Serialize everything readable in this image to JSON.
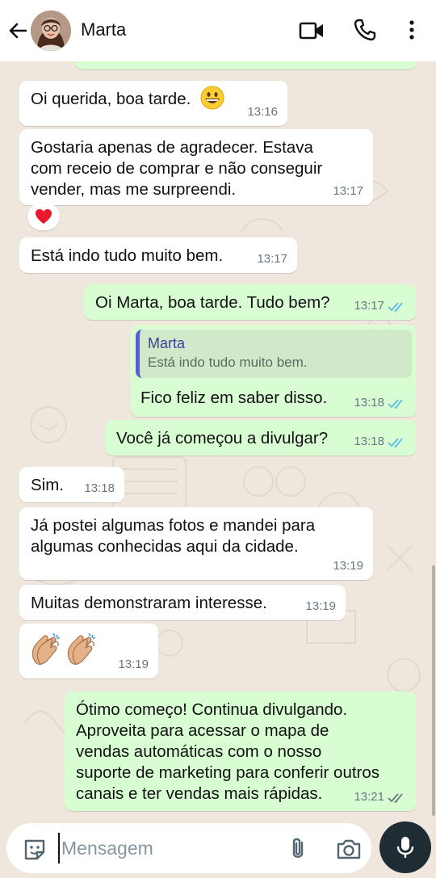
{
  "header": {
    "contact_name": "Marta"
  },
  "messages": [
    {
      "dir": "in",
      "text": "Oi querida, boa tarde.",
      "time": "13:16",
      "emoji": "grinning-face"
    },
    {
      "dir": "in",
      "text": "Gostaria apenas de agradecer. Estava\ncom receio de comprar e não conseguir\nvender, mas me surpreendi.",
      "time": "13:17",
      "reaction": "❤️"
    },
    {
      "dir": "in",
      "text": "Está indo tudo muito bem.",
      "time": "13:17"
    },
    {
      "dir": "out",
      "text": "Oi Marta, boa tarde. Tudo bem?",
      "time": "13:17",
      "status": "read"
    },
    {
      "dir": "out",
      "text": "Fico feliz em saber disso.",
      "time": "13:18",
      "status": "read",
      "quote": {
        "name": "Marta",
        "text": "Está indo tudo muito bem."
      }
    },
    {
      "dir": "out",
      "text": "Você já começou a divulgar?",
      "time": "13:18",
      "status": "read"
    },
    {
      "dir": "in",
      "text": "Sim.",
      "time": "13:18"
    },
    {
      "dir": "in",
      "text": "Já postei algumas fotos e mandei para\nalgumas conhecidas aqui da cidade.",
      "time": "13:19"
    },
    {
      "dir": "in",
      "text": "Muitas demonstraram interesse.",
      "time": "13:19"
    },
    {
      "dir": "in",
      "text": "",
      "time": "13:19",
      "emoji": "clapping-hands x2"
    },
    {
      "dir": "out",
      "text": "Ótimo começo! Continua divulgando.\nAproveita para acessar o  mapa de\nvendas automáticas com o nosso\nsuporte de marketing para conferir outros\ncanais e ter vendas mais rápidas.",
      "time": "13:21",
      "status": "delivered"
    }
  ],
  "composer": {
    "placeholder": "Mensagem"
  },
  "colors": {
    "incoming_bubble": "#ffffff",
    "outgoing_bubble": "#d9fdd3",
    "read_ticks": "#53bdeb",
    "delivered_ticks": "#667781",
    "mic_button": "#1f2c34"
  }
}
